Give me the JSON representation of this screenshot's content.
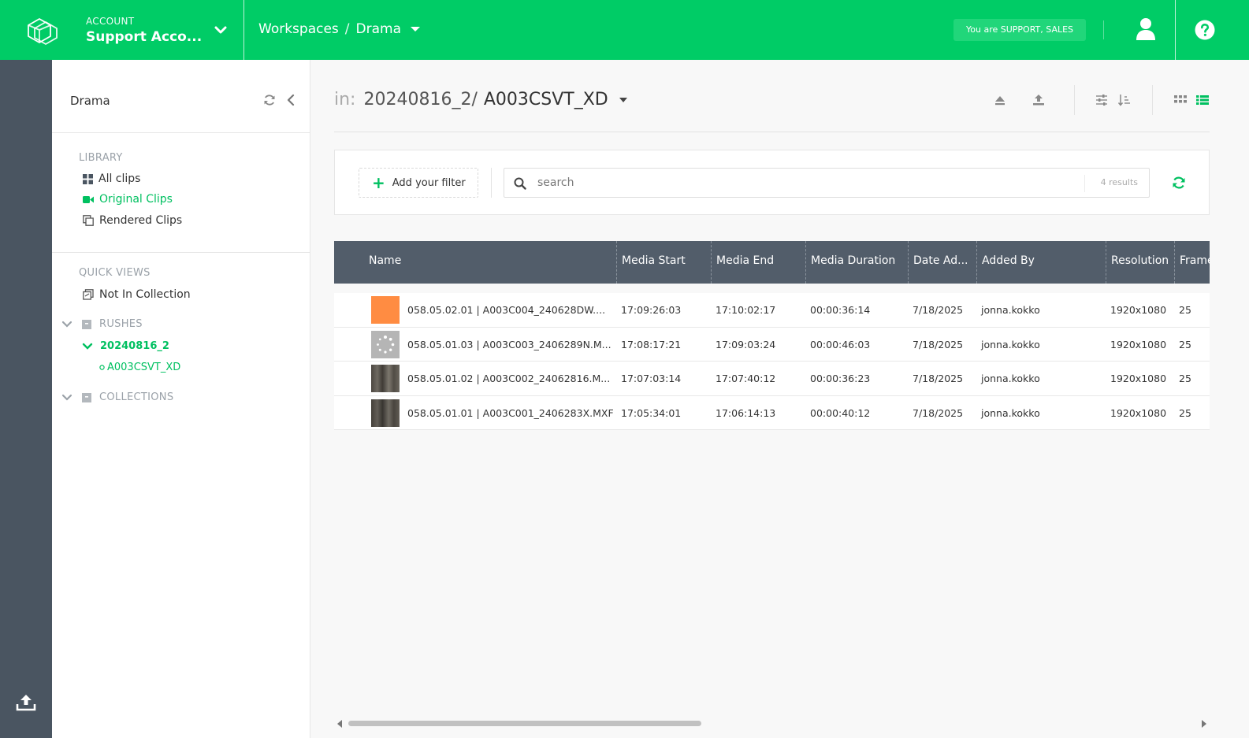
{
  "header": {
    "account_label": "ACCOUNT",
    "account_name": "Support Acco...",
    "breadcrumb_root": "Workspaces",
    "breadcrumb_sep": "/",
    "breadcrumb_current": "Drama",
    "role_badge": "You are SUPPORT, SALES"
  },
  "sidebar": {
    "title": "Drama",
    "library_title": "LIBRARY",
    "library_items": [
      {
        "label": "All clips",
        "icon": "grid-icon",
        "active": false
      },
      {
        "label": "Original Clips",
        "icon": "video-camera-icon",
        "active": true
      },
      {
        "label": "Rendered Clips",
        "icon": "copy-icon",
        "active": false
      }
    ],
    "quick_views_title": "QUICK VIEWS",
    "quick_views_items": [
      {
        "label": "Not In Collection",
        "icon": "collection-off-icon"
      }
    ],
    "rushes_title": "RUSHES",
    "rushes_folder": "20240816_2",
    "rushes_subfolder": "A003CSVT_XD",
    "collections_title": "COLLECTIONS"
  },
  "main": {
    "path_prefix": "in:",
    "path_parent": "20240816_2",
    "path_sep": "/",
    "path_current": "A003CSVT_XD",
    "add_filter_label": "Add your filter",
    "search_placeholder": "search",
    "results_text": "4 results"
  },
  "table": {
    "columns": [
      "Name",
      "Media Start",
      "Media End",
      "Media Duration",
      "Date Ad...",
      "Added By",
      "Resolution",
      "Frame"
    ],
    "rows": [
      {
        "thumb": "orange",
        "name": "058.05.02.01 | A003C004_240628DW....",
        "media_start": "17:09:26:03",
        "media_end": "17:10:02:17",
        "duration": "00:00:36:14",
        "date_added": "7/18/2025",
        "added_by": "jonna.kokko",
        "resolution": "1920x1080",
        "frame": "25"
      },
      {
        "thumb": "loading",
        "name": "058.05.01.03 | A003C003_2406289N.M...",
        "media_start": "17:08:17:21",
        "media_end": "17:09:03:24",
        "duration": "00:00:46:03",
        "date_added": "7/18/2025",
        "added_by": "jonna.kokko",
        "resolution": "1920x1080",
        "frame": "25"
      },
      {
        "thumb": "film",
        "name": "058.05.01.02 | A003C002_24062816.M...",
        "media_start": "17:07:03:14",
        "media_end": "17:07:40:12",
        "duration": "00:00:36:23",
        "date_added": "7/18/2025",
        "added_by": "jonna.kokko",
        "resolution": "1920x1080",
        "frame": "25"
      },
      {
        "thumb": "film",
        "name": "058.05.01.01 | A003C001_2406283X.MXF",
        "media_start": "17:05:34:01",
        "media_end": "17:06:14:13",
        "duration": "00:00:40:12",
        "date_added": "7/18/2025",
        "added_by": "jonna.kokko",
        "resolution": "1920x1080",
        "frame": "25"
      }
    ]
  },
  "colors": {
    "brand_green": "#00cc66",
    "rail_dark": "#4a5561",
    "table_header": "#525d6a",
    "thumb_orange": "#ff8c42"
  }
}
